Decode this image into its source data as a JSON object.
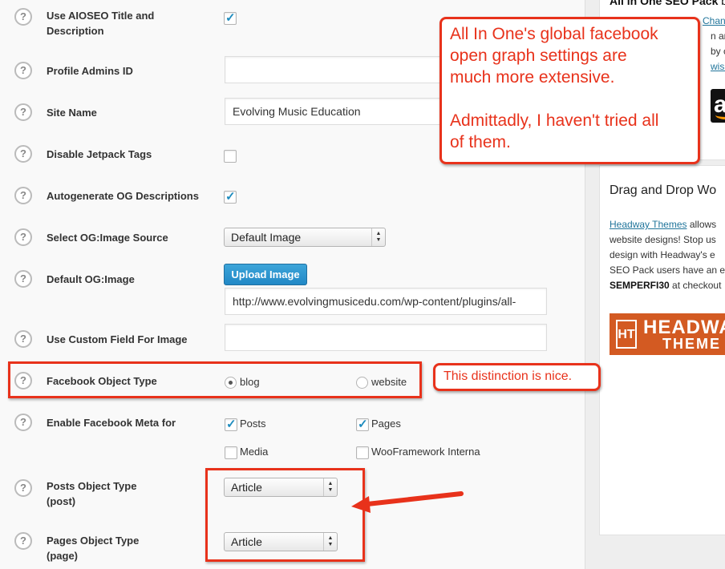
{
  "settings": {
    "use_title_desc": {
      "label_line1": "Use AIOSEO Title and",
      "label_line2": "Description",
      "checked": true
    },
    "profile_admins": {
      "label": "Profile Admins ID",
      "value": ""
    },
    "site_name": {
      "label": "Site Name",
      "value": "Evolving Music Education"
    },
    "disable_jetpack": {
      "label": "Disable Jetpack Tags",
      "checked": false
    },
    "autogenerate_og": {
      "label": "Autogenerate OG Descriptions",
      "checked": true
    },
    "og_image_source": {
      "label": "Select OG:Image Source",
      "selected": "Default Image"
    },
    "default_og_image": {
      "label": "Default OG:Image",
      "button_label": "Upload Image",
      "url": "http://www.evolvingmusicedu.com/wp-content/plugins/all-"
    },
    "custom_field_image": {
      "label": "Use Custom Field For Image",
      "value": ""
    },
    "facebook_object_type": {
      "label": "Facebook Object Type",
      "options": [
        "blog",
        "website"
      ],
      "selected": "blog"
    },
    "enable_fb_meta": {
      "label": "Enable Facebook Meta for",
      "options": [
        {
          "label": "Posts",
          "checked": true
        },
        {
          "label": "Pages",
          "checked": true
        },
        {
          "label": "Media",
          "checked": false
        },
        {
          "label": "WooFramework Interna",
          "checked": false
        }
      ]
    },
    "posts_object_type": {
      "label_line1": "Posts Object Type",
      "label_line2": "(post)",
      "selected": "Article"
    },
    "pages_object_type": {
      "label_line1": "Pages Object Type",
      "label_line2": "(page)",
      "selected": "Article"
    },
    "help_icon_glyph": "?"
  },
  "sidebar": {
    "box1_title": "All in One SEO Pack",
    "box1_title_suffix": "b",
    "box1_fragments": [
      "Chang",
      "n and",
      "by cli",
      "wishli"
    ],
    "amazon_glyph": "a",
    "box2_title": "Drag and Drop Wo",
    "box2_link": "Headway Themes",
    "box2_text_1": " allows",
    "box2_text_2": "website designs! Stop us",
    "box2_text_3": "design with Headway's e",
    "box2_text_4": "SEO Pack users have an e",
    "box2_code": "SEMPERFI30",
    "box2_text_5": " at checkout",
    "banner_logo": "HT",
    "banner_word": "HEADWA",
    "banner_word2": "THEME"
  },
  "annotations": {
    "big_callout_line1": "All In One's global facebook",
    "big_callout_line2": "open graph settings are",
    "big_callout_line3": "much more extensive.",
    "big_callout_line4": "Admittadly, I haven't tried all",
    "big_callout_line5": "of them.",
    "small_callout": "This distinction is nice."
  },
  "colors": {
    "annotation_red": "#e8321b",
    "wp_blue": "#2188c6",
    "link_blue": "#21759b",
    "headway_orange": "#d35a22"
  }
}
